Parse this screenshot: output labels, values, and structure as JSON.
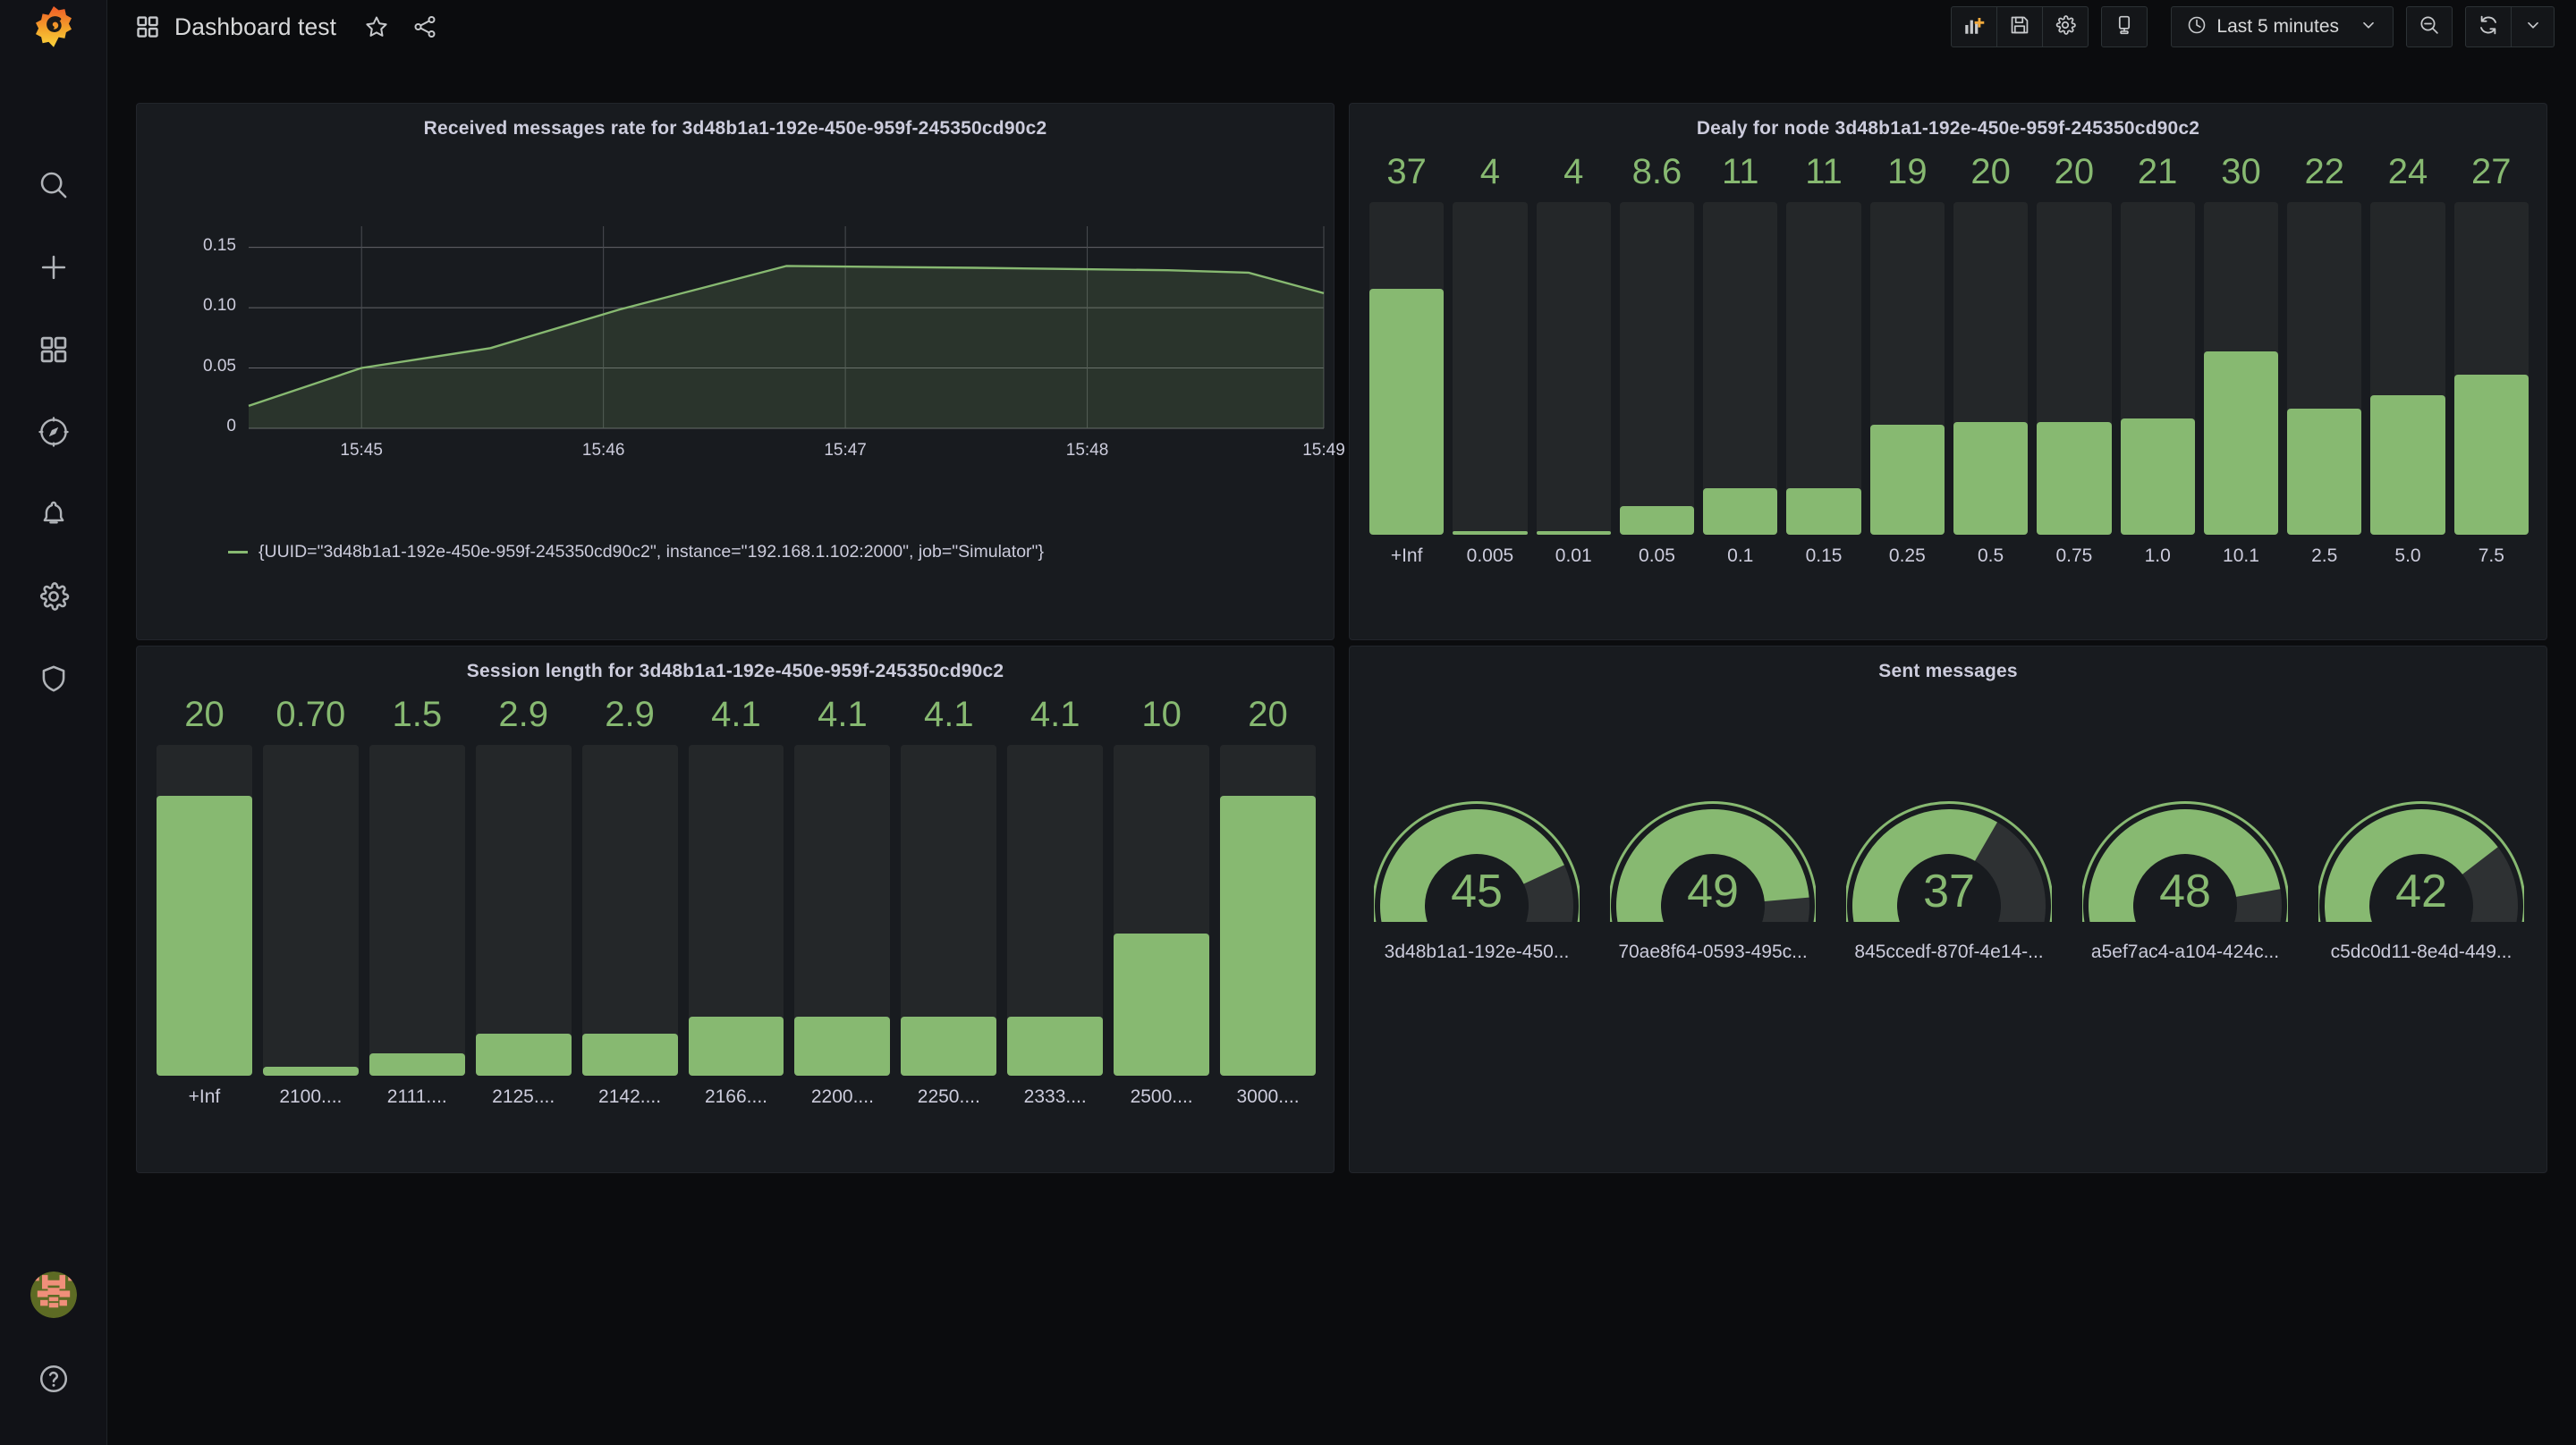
{
  "brand": {
    "logo": "grafana-logo"
  },
  "topbar": {
    "dashboard_icon": "apps-grid-icon",
    "title": "Dashboard test",
    "star_icon": "star-icon",
    "share_icon": "share-icon",
    "add_panel_icon": "add-panel-icon",
    "save_icon": "save-dashboard-icon",
    "settings_icon": "dashboard-settings-icon",
    "tv_icon": "cycle-view-mode-icon",
    "time_icon": "clock-icon",
    "time_range": "Last 5 minutes",
    "time_caret_icon": "chevron-down-icon",
    "zoom_out_icon": "zoom-out-icon",
    "refresh_icon": "refresh-icon",
    "refresh_caret_icon": "chevron-down-icon"
  },
  "sidebar": {
    "items": [
      {
        "name": "search",
        "icon": "search-icon"
      },
      {
        "name": "create",
        "icon": "plus-icon"
      },
      {
        "name": "dashboards",
        "icon": "apps-grid-icon"
      },
      {
        "name": "explore",
        "icon": "compass-icon"
      },
      {
        "name": "alerting",
        "icon": "bell-icon"
      },
      {
        "name": "configuration",
        "icon": "gear-icon"
      },
      {
        "name": "server-admin",
        "icon": "shield-icon"
      }
    ],
    "bottom": [
      {
        "name": "user-profile",
        "icon": "avatar"
      },
      {
        "name": "help",
        "icon": "question-circle-icon"
      }
    ]
  },
  "colors": {
    "accent_green": "#87b971",
    "panel_bg": "#181b1f",
    "page_bg": "#0b0c0e",
    "track": "#242729",
    "text": "#ccccdc"
  },
  "chart_data": [
    {
      "id": "received-messages-rate",
      "type": "area",
      "title": "Received messages rate for 3d48b1a1-192e-450e-959f-245350cd90c2",
      "xlabel": "",
      "ylabel": "",
      "ylim": [
        0,
        0.1675
      ],
      "yticks": [
        "0",
        "0.05",
        "0.10",
        "0.15"
      ],
      "ytick_values": [
        0,
        0.05,
        0.1,
        0.15
      ],
      "xticks": [
        "15:45",
        "15:46",
        "15:47",
        "15:48",
        "15:49"
      ],
      "grid": true,
      "legend": [
        "{UUID=\"3d48b1a1-192e-450e-959f-245350cd90c2\", instance=\"192.168.1.102:2000\", job=\"Simulator\"}"
      ],
      "legend_position": "bottom",
      "series": [
        {
          "name": "{UUID=\"3d48b1a1-192e-450e-959f-245350cd90c2\", instance=\"192.168.1.102:2000\", job=\"Simulator\"}",
          "color": "#87b971",
          "x": [
            0.0,
            0.105,
            0.225,
            0.345,
            0.425,
            0.5,
            0.675,
            0.855,
            0.93,
            1.0
          ],
          "values": [
            0.0186,
            0.05,
            0.0665,
            0.0985,
            0.117,
            0.1345,
            0.133,
            0.131,
            0.129,
            0.112
          ]
        }
      ]
    },
    {
      "id": "delay-for-node",
      "type": "bar",
      "title": "Dealy for node 3d48b1a1-192e-450e-959f-245350cd90c2",
      "categories": [
        "+Inf",
        "0.005",
        "0.01",
        "0.05",
        "0.1",
        "0.15",
        "0.25",
        "0.5",
        "0.75",
        "1.0",
        "10.1",
        "2.5",
        "5.0",
        "7.5"
      ],
      "display_values": [
        "37",
        "4",
        "4",
        "8.6",
        "11",
        "11",
        "19",
        "20",
        "20",
        "21",
        "30",
        "22",
        "24",
        "27"
      ],
      "values": [
        37,
        4,
        4,
        8.6,
        11,
        11,
        19,
        20,
        20,
        21,
        30,
        22,
        24,
        27
      ],
      "fill_fraction": [
        0.74,
        0.012,
        0.012,
        0.085,
        0.14,
        0.14,
        0.33,
        0.34,
        0.34,
        0.35,
        0.55,
        0.38,
        0.42,
        0.48
      ],
      "ylim": [
        0,
        50
      ],
      "xlabel": "",
      "ylabel": "",
      "grid": false
    },
    {
      "id": "session-length",
      "type": "bar",
      "title": "Session length for 3d48b1a1-192e-450e-959f-245350cd90c2",
      "categories": [
        "+Inf",
        "2100....",
        "2111....",
        "2125....",
        "2142....",
        "2166....",
        "2200....",
        "2250....",
        "2333....",
        "2500....",
        "3000...."
      ],
      "display_values": [
        "20",
        "0.70",
        "1.5",
        "2.9",
        "2.9",
        "4.1",
        "4.1",
        "4.1",
        "4.1",
        "10",
        "20"
      ],
      "values": [
        20,
        0.7,
        1.5,
        2.9,
        2.9,
        4.1,
        4.1,
        4.1,
        4.1,
        10,
        20
      ],
      "fill_fraction": [
        0.845,
        0.028,
        0.068,
        0.128,
        0.128,
        0.178,
        0.178,
        0.178,
        0.178,
        0.43,
        0.845
      ],
      "ylim": [
        0,
        23
      ],
      "xlabel": "",
      "ylabel": "",
      "grid": false
    },
    {
      "id": "sent-messages",
      "type": "gauge",
      "title": "Sent messages",
      "categories": [
        "3d48b1a1-192e-450...",
        "70ae8f64-0593-495c...",
        "845ccedf-870f-4e14-...",
        "a5ef7ac4-a104-424c...",
        "c5dc0d11-8e4d-449..."
      ],
      "values": [
        45,
        49,
        37,
        48,
        42
      ],
      "display_values": [
        "45",
        "49",
        "37",
        "48",
        "42"
      ],
      "fill_fraction": [
        0.76,
        0.84,
        0.62,
        0.82,
        0.71
      ],
      "ylim": [
        0,
        60
      ]
    }
  ],
  "panels": [
    {
      "id": "received-messages-rate",
      "title": "Received messages rate for 3d48b1a1-192e-450e-959f-245350cd90c2"
    },
    {
      "id": "delay-for-node",
      "title": "Dealy for node 3d48b1a1-192e-450e-959f-245350cd90c2"
    },
    {
      "id": "session-length",
      "title": "Session length for 3d48b1a1-192e-450e-959f-245350cd90c2"
    },
    {
      "id": "sent-messages",
      "title": "Sent messages"
    }
  ]
}
